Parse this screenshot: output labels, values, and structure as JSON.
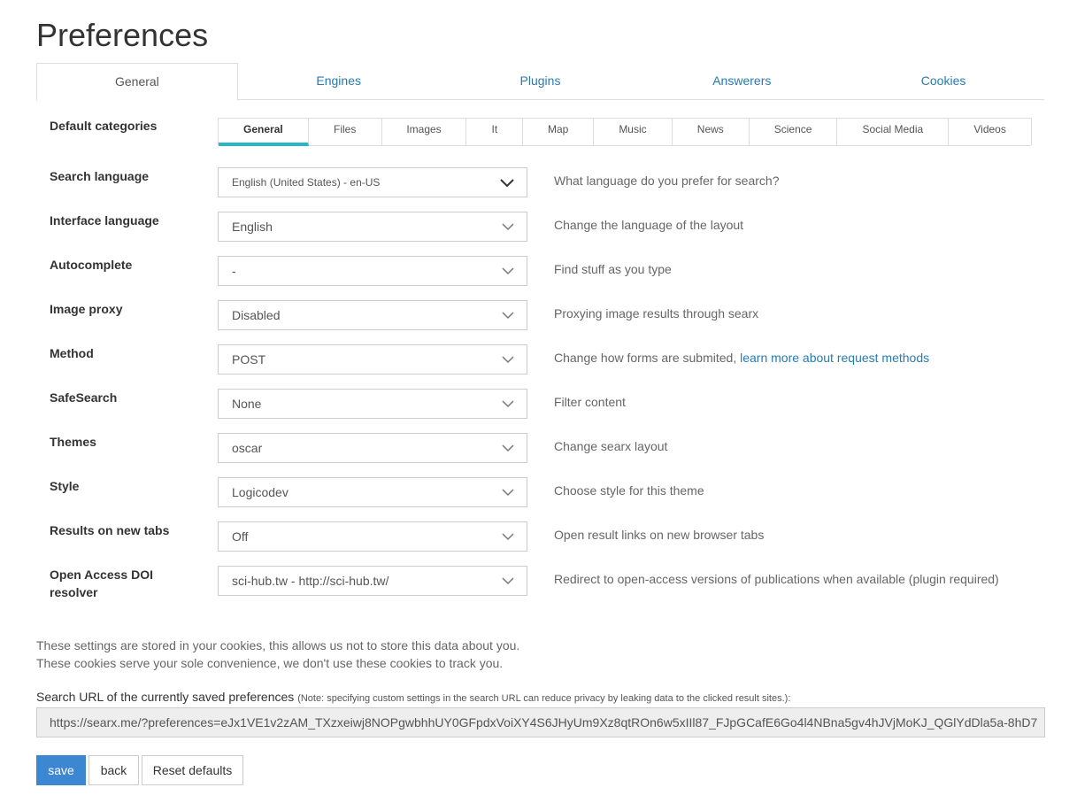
{
  "page_title": "Preferences",
  "main_tabs": [
    {
      "label": "General",
      "active": true
    },
    {
      "label": "Engines",
      "active": false
    },
    {
      "label": "Plugins",
      "active": false
    },
    {
      "label": "Answerers",
      "active": false
    },
    {
      "label": "Cookies",
      "active": false
    }
  ],
  "categories": {
    "label": "Default categories",
    "items": [
      {
        "label": "General",
        "active": true
      },
      {
        "label": "Files",
        "active": false
      },
      {
        "label": "Images",
        "active": false
      },
      {
        "label": "It",
        "active": false
      },
      {
        "label": "Map",
        "active": false
      },
      {
        "label": "Music",
        "active": false
      },
      {
        "label": "News",
        "active": false
      },
      {
        "label": "Science",
        "active": false
      },
      {
        "label": "Social Media",
        "active": false
      },
      {
        "label": "Videos",
        "active": false
      }
    ]
  },
  "settings": [
    {
      "label": "Search language",
      "value": "English (United States) - en-US",
      "help": "What language do you prefer for search?"
    },
    {
      "label": "Interface language",
      "value": "English",
      "help": "Change the language of the layout"
    },
    {
      "label": "Autocomplete",
      "value": "-",
      "help": "Find stuff as you type"
    },
    {
      "label": "Image proxy",
      "value": "Disabled",
      "help": "Proxying image results through searx"
    },
    {
      "label": "Method",
      "value": "POST",
      "help": "Change how forms are submited,",
      "help_link": "learn more about request methods"
    },
    {
      "label": "SafeSearch",
      "value": "None",
      "help": "Filter content"
    },
    {
      "label": "Themes",
      "value": "oscar",
      "help": "Change searx layout"
    },
    {
      "label": "Style",
      "value": "Logicodev",
      "help": "Choose style for this theme"
    },
    {
      "label": "Results on new tabs",
      "value": "Off",
      "help": "Open result links on new browser tabs"
    },
    {
      "label": "Open Access DOI resolver",
      "value": "sci-hub.tw - http://sci-hub.tw/",
      "help": "Redirect to open-access versions of publications when available (plugin required)"
    }
  ],
  "cookie_notice": {
    "line1": "These settings are stored in your cookies, this allows us not to store this data about you.",
    "line2": "These cookies serve your sole convenience, we don't use these cookies to track you."
  },
  "search_url": {
    "caption": "Search URL of the currently saved preferences",
    "note": "(Note: specifying custom settings in the search URL can reduce privacy by leaking data to the clicked result sites.):",
    "value": "https://searx.me/?preferences=eJx1VE1v2zAM_TXzxeiwj8NOPgwbhhUY0GFpdxVoiXY4S6JHyUm9Xz8qtROn6w5xIIl87_FJpGCafE6Go4l4NBna5gv4hJVjMoKJ_QGlYdDla5a-8hD7"
  },
  "buttons": {
    "save": "save",
    "back": "back",
    "reset": "Reset defaults"
  },
  "colors": {
    "link": "#2a7ab0",
    "accent_underline": "#29b6c6",
    "primary_button": "#3d87d2"
  }
}
